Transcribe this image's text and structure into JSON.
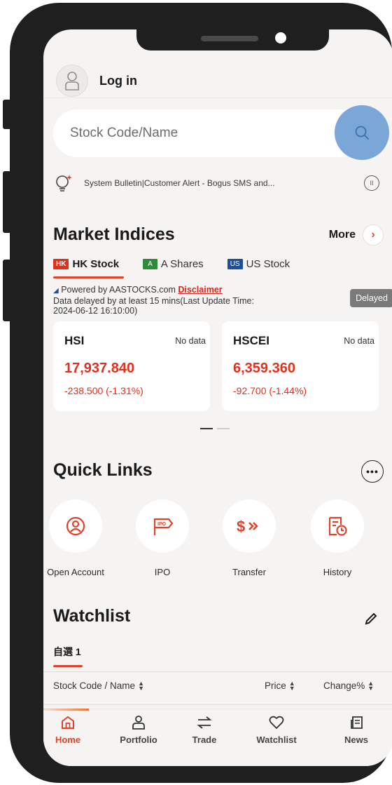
{
  "header": {
    "login_label": "Log in"
  },
  "search": {
    "placeholder": "Stock Code/Name"
  },
  "bulletin": {
    "text": "System Bulletin|Customer Alert - Bogus SMS and..."
  },
  "market_indices": {
    "title": "Market Indices",
    "more_label": "More",
    "tabs": [
      {
        "flag": "HK",
        "label": "HK Stock",
        "flag_color": "#e0301e",
        "active": true
      },
      {
        "flag": "A",
        "label": "A Shares",
        "flag_color": "#2e8b3a",
        "active": false
      },
      {
        "flag": "US",
        "label": "US Stock",
        "flag_color": "#1d4f9c",
        "active": false
      }
    ],
    "powered_prefix": "Powered by AASTOCKS.com",
    "disclaimer": "Disclaimer",
    "delay_line1": "Data delayed by at least 15 mins(Last Update Time:",
    "delay_line2": "2024-06-12 16:10:00)",
    "delayed_badge": "Delayed",
    "cards": [
      {
        "name": "HSI",
        "status": "No data",
        "value": "17,937.840",
        "change": "-238.500 (-1.31%)"
      },
      {
        "name": "HSCEI",
        "status": "No data",
        "value": "6,359.360",
        "change": "-92.700 (-1.44%)"
      }
    ]
  },
  "quick_links": {
    "title": "Quick Links",
    "items": [
      {
        "label": "Open Account",
        "icon": "user-circle-icon"
      },
      {
        "label": "IPO",
        "icon": "ipo-flag-icon"
      },
      {
        "label": "Transfer",
        "icon": "dollar-transfer-icon"
      },
      {
        "label": "History",
        "icon": "history-doc-icon"
      }
    ]
  },
  "watchlist": {
    "title": "Watchlist",
    "tab_label": "自選 1",
    "col_name": "Stock Code / Name",
    "col_price": "Price",
    "col_change": "Change%"
  },
  "tabbar": {
    "items": [
      {
        "label": "Home",
        "icon": "home-icon",
        "active": true
      },
      {
        "label": "Portfolio",
        "icon": "person-icon",
        "active": false
      },
      {
        "label": "Trade",
        "icon": "swap-arrows-icon",
        "active": false
      },
      {
        "label": "Watchlist",
        "icon": "heart-icon",
        "active": false
      },
      {
        "label": "News",
        "icon": "news-icon",
        "active": false
      }
    ]
  },
  "colors": {
    "accent": "#e0432d",
    "search_highlight": "#7aa6d8",
    "background": "#f6f4f2"
  }
}
